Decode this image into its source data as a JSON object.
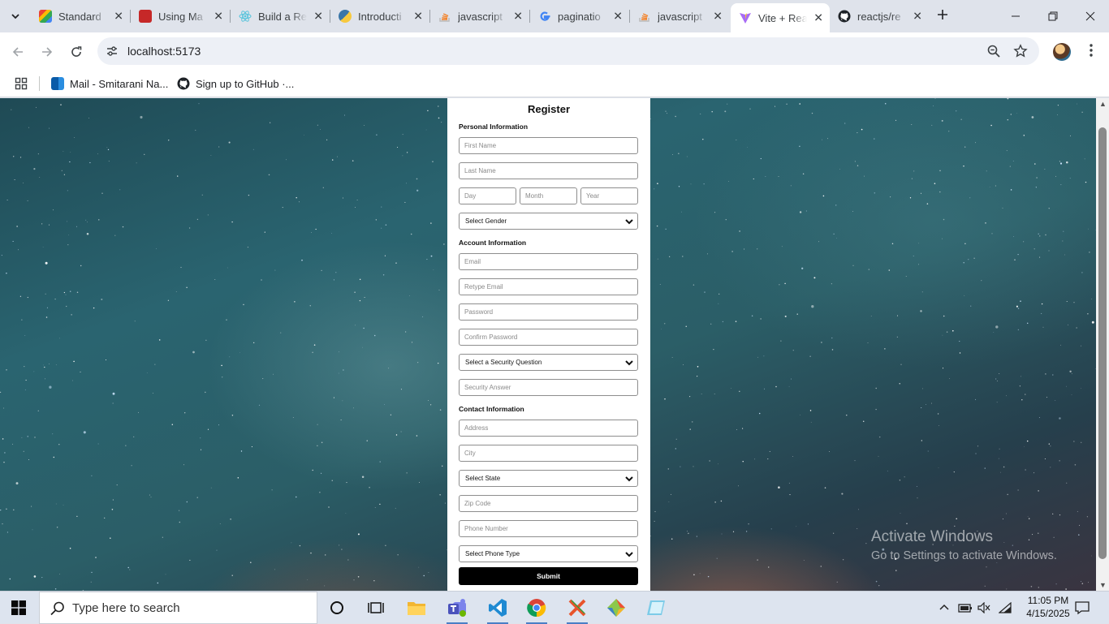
{
  "browser": {
    "tabs": [
      {
        "title": "Standard",
        "icon": "gmail-icon"
      },
      {
        "title": "Using Ma",
        "icon": "app-icon"
      },
      {
        "title": "Build a Re",
        "icon": "react-icon"
      },
      {
        "title": "Introducti",
        "icon": "python-icon"
      },
      {
        "title": "javascript",
        "icon": "stackoverflow-icon"
      },
      {
        "title": "paginatio",
        "icon": "google-icon"
      },
      {
        "title": "javascript",
        "icon": "stackoverflow-icon"
      },
      {
        "title": "Vite + Rea",
        "icon": "vite-icon",
        "active": true
      },
      {
        "title": "reactjs/re",
        "icon": "github-icon"
      }
    ],
    "url": "localhost:5173",
    "bookmarks": [
      {
        "label": "Mail - Smitarani Na...",
        "icon": "outlook-icon"
      },
      {
        "label": "Sign up to GitHub ·...",
        "icon": "github-icon"
      }
    ]
  },
  "form": {
    "title": "Register",
    "sections": {
      "personal": "Personal Information",
      "account": "Account Information",
      "contact": "Contact Information"
    },
    "placeholders": {
      "first_name": "First Name",
      "last_name": "Last Name",
      "day": "Day",
      "month": "Month",
      "year": "Year",
      "email": "Email",
      "retype_email": "Retype Email",
      "password": "Password",
      "confirm_password": "Confirm Password",
      "security_answer": "Security Answer",
      "address": "Address",
      "city": "City",
      "zip": "Zip Code",
      "phone": "Phone Number"
    },
    "selects": {
      "gender": "Select Gender",
      "security_question": "Select a Security Question",
      "state": "Select State",
      "phone_type": "Select Phone Type"
    },
    "submit": "Submit"
  },
  "watermark": {
    "line1": "Activate Windows",
    "line2": "Go to Settings to activate Windows."
  },
  "taskbar": {
    "search_placeholder": "Type here to search",
    "time": "11:05 PM",
    "date": "4/15/2025"
  },
  "colors": {
    "accent": "#4a7ec5",
    "submit_bg": "#000000",
    "chrome_bg": "#dfe3eb"
  }
}
